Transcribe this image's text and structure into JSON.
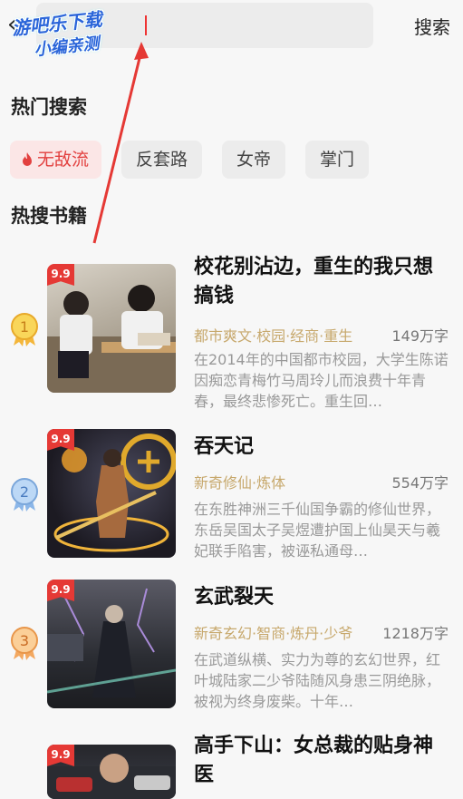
{
  "topbar": {
    "search_label": "搜索"
  },
  "watermark": {
    "line1": "游吧乐下载",
    "line2": "小编亲测"
  },
  "hot": {
    "title": "热门搜索",
    "chips": [
      "无敌流",
      "反套路",
      "女帝",
      "掌门"
    ]
  },
  "books_title": "热搜书籍",
  "books": [
    {
      "rank": "1",
      "score": "9.9",
      "title": "校花别沾边，重生的我只想搞钱",
      "tags": "都市爽文·校园·经商·重生",
      "words": "149万字",
      "desc": "在2014年的中国都市校园，大学生陈诺因痴恋青梅竹马周玲儿而浪费十年青春，最终悲惨死亡。重生回…"
    },
    {
      "rank": "2",
      "score": "9.9",
      "title": "吞天记",
      "tags": "新奇修仙·炼体",
      "words": "554万字",
      "desc": "在东胜神洲三千仙国争霸的修仙世界，东岳吴国太子吴煜遭护国上仙昊天与羲妃联手陷害，被诬私通母…"
    },
    {
      "rank": "3",
      "score": "9.9",
      "title": "玄武裂天",
      "tags": "新奇玄幻·智商·炼丹·少爷",
      "words": "1218万字",
      "desc": "在武道纵横、实力为尊的玄幻世界，红叶城陆家二少爷陆随风身患三阴绝脉，被视为终身废柴。十年…"
    },
    {
      "score": "9.9",
      "title": "高手下山：女总裁的贴身神医"
    }
  ],
  "colors": {
    "accent": "#e53935",
    "tag": "#c7a86c",
    "gold": "#f4c542",
    "silver": "#8fb8e8",
    "bronze": "#f1a25b"
  }
}
